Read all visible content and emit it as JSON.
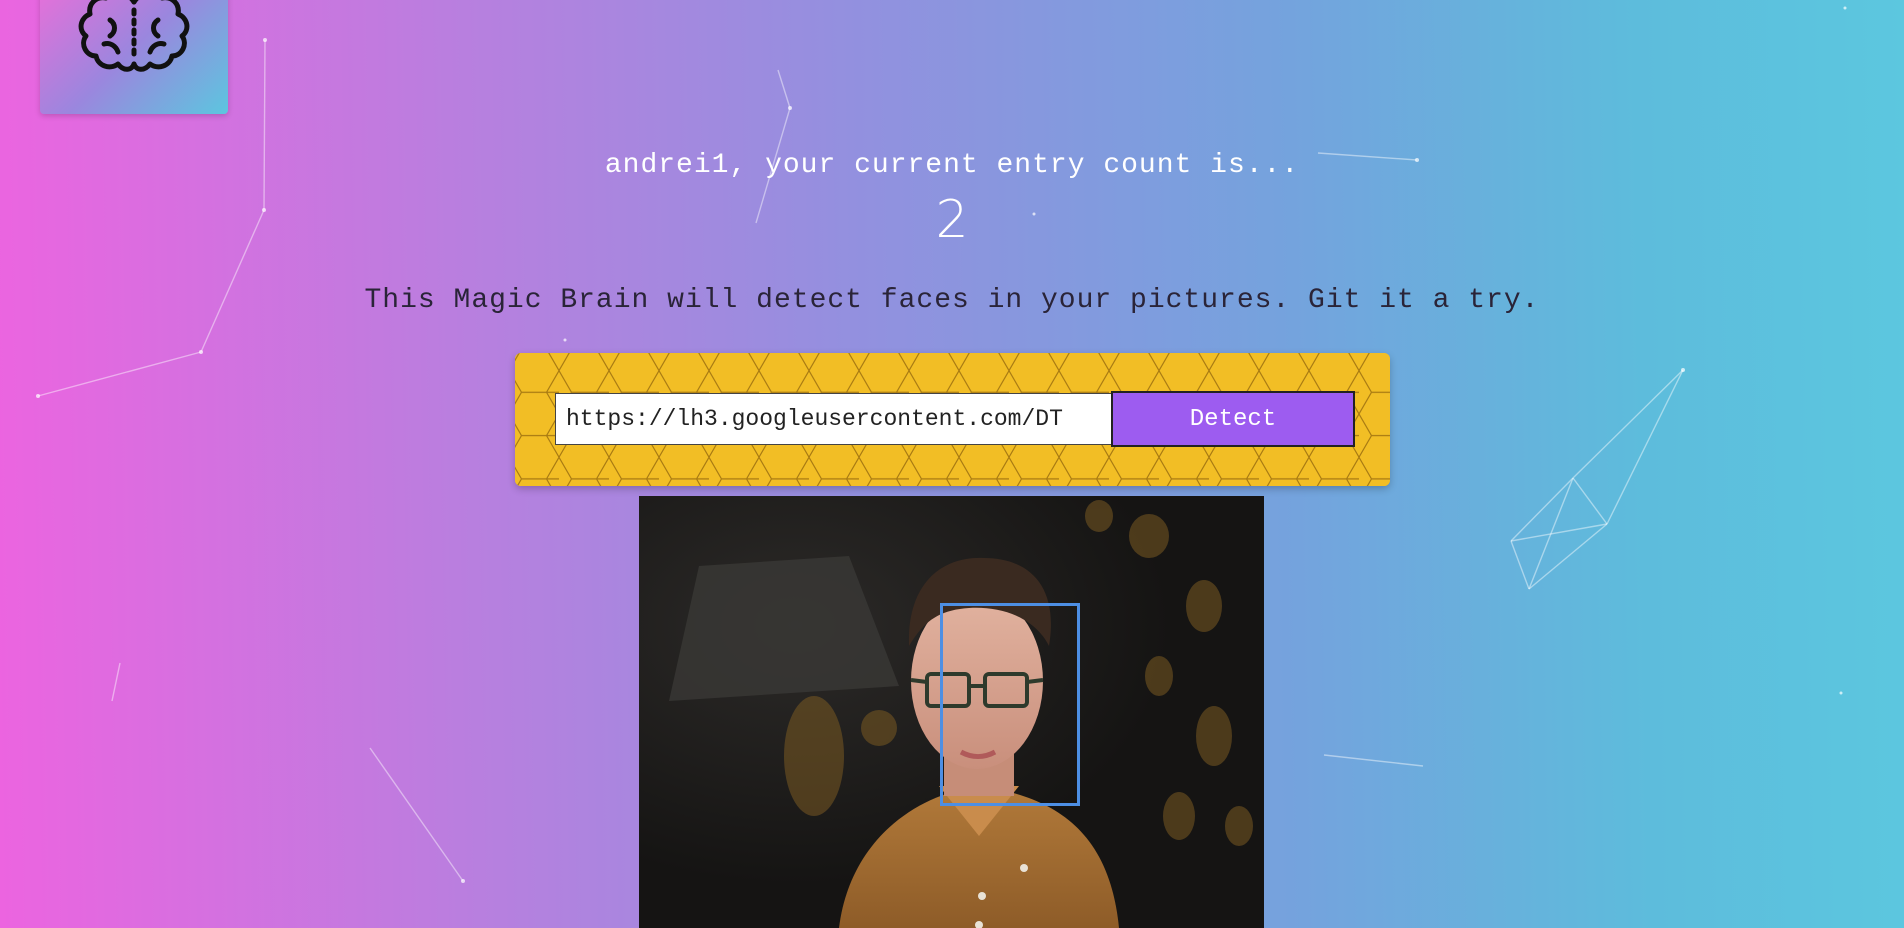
{
  "app": {
    "logo_icon": "brain-icon"
  },
  "greeting": {
    "text": "andrei1, your current entry count is...",
    "count": "2"
  },
  "tagline": "This Magic Brain will detect faces in your pictures. Git it a try.",
  "form": {
    "url_value": "https://lh3.googleusercontent.com/DT",
    "detect_label": "Detect"
  },
  "result": {
    "image_icon": "portrait-photo",
    "faces_detected": 1
  },
  "colors": {
    "gradient_start": "#ec64e0",
    "gradient_end": "#5cc7df",
    "form_background": "#f2be25",
    "button": "#9d5cf0",
    "face_box": "#4d8fe4"
  }
}
